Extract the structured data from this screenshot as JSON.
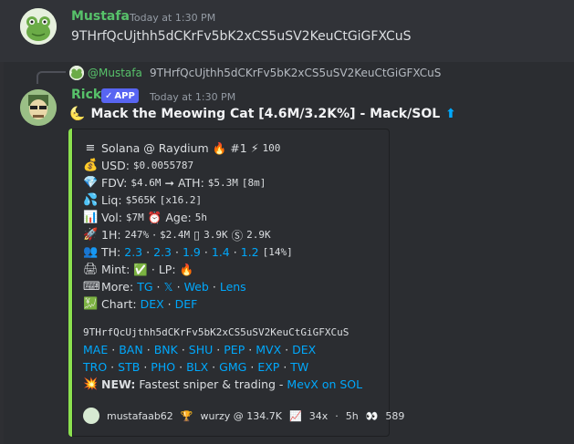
{
  "message1": {
    "username": "Mustafa",
    "timestamp": "Today at 1:30 PM",
    "content": "9THrfQcUjthh5dCKrFv5bK2xCS5uSV2KeuCtGiGFXCuS"
  },
  "message2": {
    "reply": {
      "mention": "@Mustafa",
      "text": "9THrfQcUjthh5dCKrFv5bK2xCS5uSV2KeuCtGiGFXCuS"
    },
    "username": "Rick",
    "app_badge": "APP",
    "timestamp": "Today at 1:30 PM",
    "title": "Mack the Meowing Cat [4.6M/3.2K%] - Mack/SOL",
    "title_arrow": "⬆"
  },
  "embed": {
    "accent_color": "#8be04e",
    "chain": "Solana @ Raydium",
    "rank": "#1",
    "score": "100",
    "usd_label": "USD:",
    "usd": "$0.0055787",
    "fdv_label": "FDV:",
    "fdv": "$4.6M",
    "ath_label": "ATH:",
    "ath": "$5.3M",
    "ath_time": "[8m]",
    "liq_label": "Liq:",
    "liq": "$565K",
    "liq_mult": "[x16.2]",
    "vol_label": "Vol:",
    "vol": "$7M",
    "age_label": "Age:",
    "age": "5h",
    "h1_label": "1H:",
    "h1_pct": "247%",
    "h1_sep": "·",
    "h1_vol": "$2.4M",
    "h1_buys": "3.9K",
    "h1_sells": "2.9K",
    "th_label": "TH:",
    "th_values": [
      "2.3",
      "2.3",
      "1.9",
      "1.4",
      "1.2"
    ],
    "th_total": "[14%]",
    "mint_label": "Mint:",
    "lp_label": "· LP:",
    "more_label": "More:",
    "more_links": [
      "TG",
      "𝕏",
      "Web",
      "Lens"
    ],
    "chart_label": "Chart:",
    "chart_links": [
      "DEX",
      "DEF"
    ],
    "contract": "9THrfQcUjthh5dCKrFv5bK2xCS5uSV2KeuCtGiGFXCuS",
    "dex_links_1": [
      "MAE",
      "BAN",
      "BNK",
      "SHU",
      "PEP",
      "MVX",
      "DEX"
    ],
    "dex_links_2": [
      "TRO",
      "STB",
      "PHO",
      "BLX",
      "GMG",
      "EXP",
      "TW"
    ],
    "new_label": "NEW:",
    "new_text": "Fastest sniper & trading -",
    "new_link": "MevX on SOL",
    "footer": {
      "user": "mustafaab62",
      "caller": "wurzy @ 134.7K",
      "mult": "34x",
      "time": "5h",
      "views": "589"
    }
  }
}
